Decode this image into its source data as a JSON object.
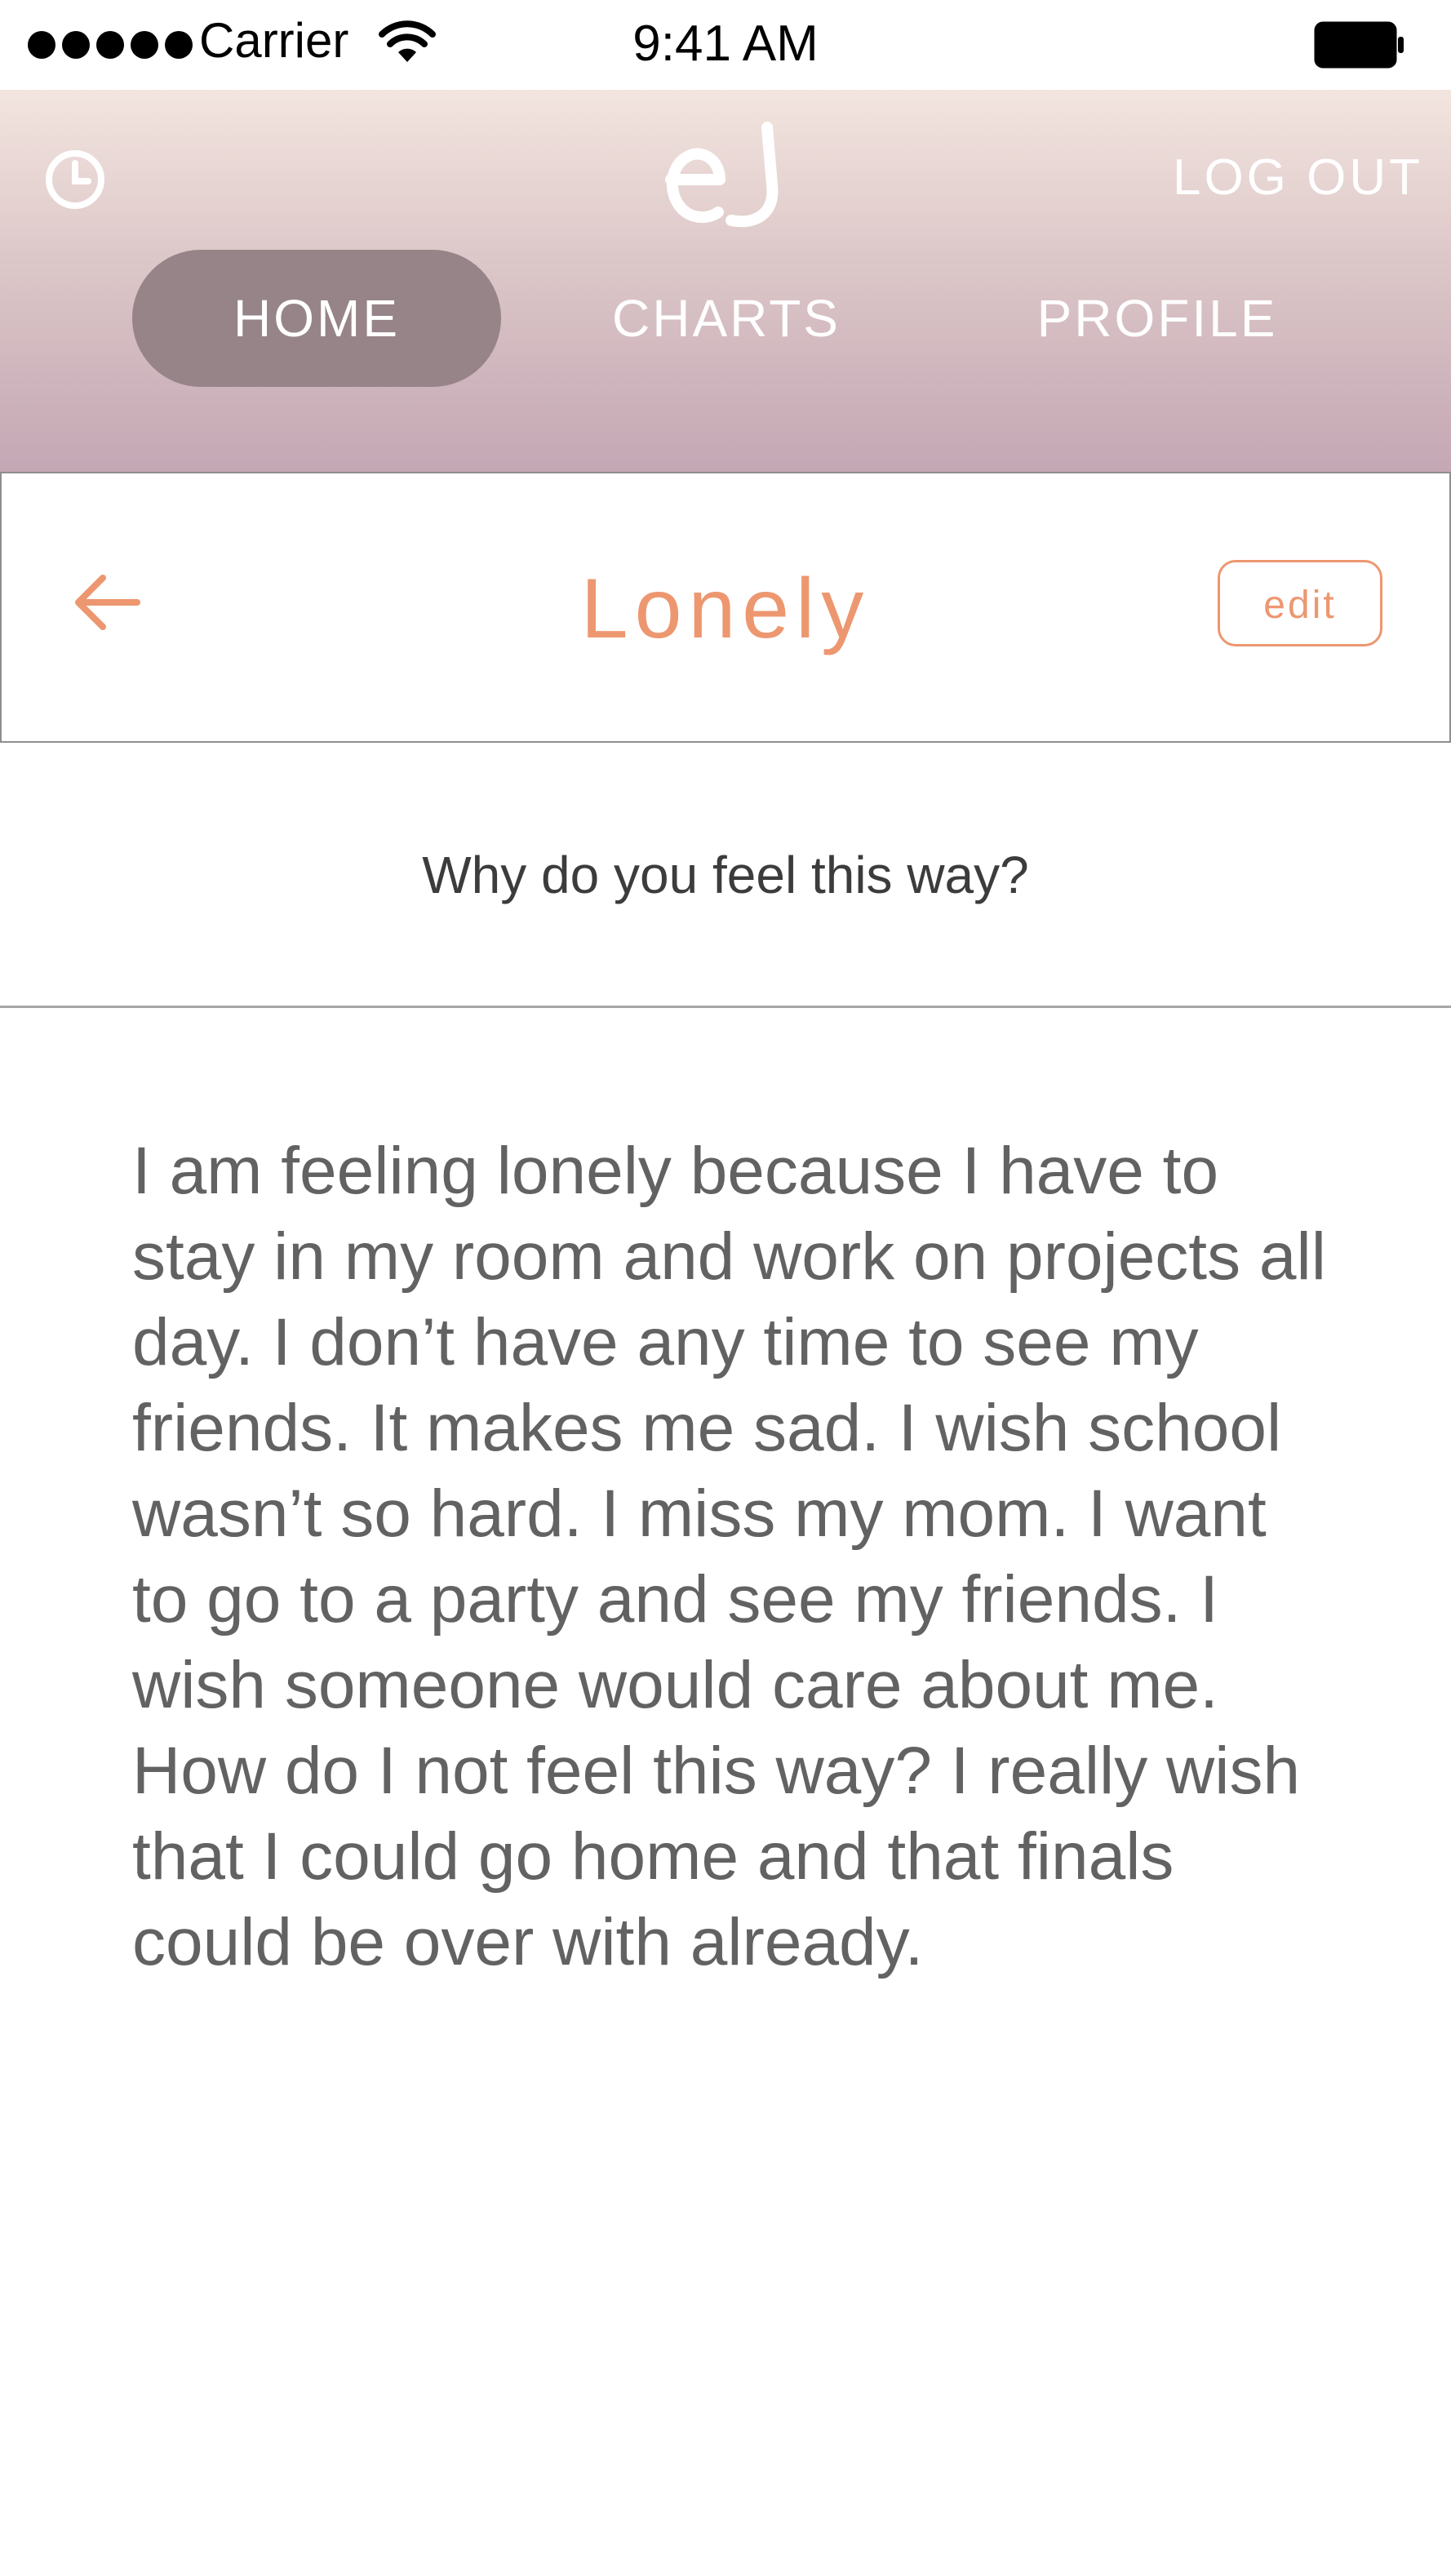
{
  "status_bar": {
    "carrier": "Carrier",
    "time": "9:41 AM"
  },
  "header": {
    "logout_label": "LOG OUT",
    "tabs": [
      {
        "label": "HOME",
        "active": true
      },
      {
        "label": "CHARTS",
        "active": false
      },
      {
        "label": "PROFILE",
        "active": false
      }
    ]
  },
  "title_bar": {
    "title": "Lonely",
    "edit_label": "edit"
  },
  "question": "Why do you feel this way?",
  "entry_text": "I am feeling lonely because I have to stay in my room and work on projects all day. I don’t have any time to see my friends. It makes me sad. I wish school wasn’t so hard. I miss my mom. I want to go to a party and see my friends. I wish someone would care about me. How do I not feel this way? I really wish that I could go home and that finals could be over with already.",
  "colors": {
    "accent": "#ed9770",
    "active_tab": "#968488",
    "header_top": "#f3e5df",
    "header_bottom": "#c4a7b4",
    "body_text": "#626262"
  },
  "icons": {
    "history": "clock-icon",
    "logo": "app-logo",
    "back": "back-arrow-icon",
    "wifi": "wifi-icon",
    "battery": "battery-icon",
    "signal": "signal-dots-icon"
  }
}
